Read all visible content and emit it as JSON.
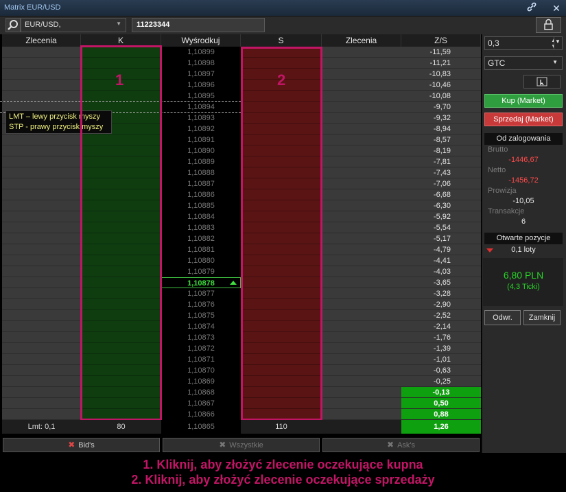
{
  "window": {
    "title": "Matrix EUR/USD"
  },
  "toolbar": {
    "symbol": "EUR/USD,",
    "account": "11223344"
  },
  "headers": {
    "zlecenia_left": "Zlecenia",
    "k": "K",
    "mid": "Wyśrodkuj",
    "s": "S",
    "zlecenia_right": "Zlecenia",
    "zs": "Z/S"
  },
  "rows": [
    {
      "price": "1,10899",
      "pl": "-11,59"
    },
    {
      "price": "1,10898",
      "pl": "-11,21"
    },
    {
      "price": "1,10897",
      "pl": "-10,83"
    },
    {
      "price": "1,10896",
      "pl": "-10,46"
    },
    {
      "price": "1,10895",
      "pl": "-10,08"
    },
    {
      "price": "1,10894",
      "pl": "-9,70"
    },
    {
      "price": "1,10893",
      "pl": "-9,32"
    },
    {
      "price": "1,10892",
      "pl": "-8,94"
    },
    {
      "price": "1,10891",
      "pl": "-8,57"
    },
    {
      "price": "1,10890",
      "pl": "-8,19"
    },
    {
      "price": "1,10889",
      "pl": "-7,81"
    },
    {
      "price": "1,10888",
      "pl": "-7,43"
    },
    {
      "price": "1,10887",
      "pl": "-7,06"
    },
    {
      "price": "1,10886",
      "pl": "-6,68"
    },
    {
      "price": "1,10885",
      "pl": "-6,30"
    },
    {
      "price": "1,10884",
      "pl": "-5,92"
    },
    {
      "price": "1,10883",
      "pl": "-5,54"
    },
    {
      "price": "1,10882",
      "pl": "-5,17"
    },
    {
      "price": "1,10881",
      "pl": "-4,79"
    },
    {
      "price": "1,10880",
      "pl": "-4,41"
    },
    {
      "price": "1,10879",
      "pl": "-4,03"
    },
    {
      "price": "1,10878",
      "pl": "-3,65"
    },
    {
      "price": "1,10877",
      "pl": "-3,28"
    },
    {
      "price": "1,10876",
      "pl": "-2,90"
    },
    {
      "price": "1,10875",
      "pl": "-2,52"
    },
    {
      "price": "1,10874",
      "pl": "-2,14"
    },
    {
      "price": "1,10873",
      "pl": "-1,76"
    },
    {
      "price": "1,10872",
      "pl": "-1,39"
    },
    {
      "price": "1,10871",
      "pl": "-1,01"
    },
    {
      "price": "1,10870",
      "pl": "-0,63"
    },
    {
      "price": "1,10869",
      "pl": "-0,25"
    },
    {
      "price": "1,10868",
      "pl": "-0,13"
    },
    {
      "price": "1,10867",
      "pl": "0,50"
    },
    {
      "price": "1,10866",
      "pl": "0,88"
    }
  ],
  "current_price_index": 21,
  "positive_from_index": 31,
  "footer": {
    "lmt": "Lmt: 0,1",
    "k_total": "80",
    "price": "1,10865",
    "s_total": "110",
    "pl": "1,26"
  },
  "tooltip": {
    "line1": "LMT – lewy przycisk myszy",
    "line2": "STP - prawy przycisk myszy"
  },
  "zones": {
    "buy": "1",
    "sell": "2"
  },
  "tabs": {
    "bids": "Bid's",
    "all": "Wszystkie",
    "asks": "Ask's"
  },
  "side": {
    "quantity": "0,3",
    "tif": "GTC",
    "buy_btn": "Kup (Market)",
    "sell_btn": "Sprzedaj (Market)",
    "since_login": "Od zalogowania",
    "brutto_label": "Brutto",
    "brutto_val": "-1446,67",
    "netto_label": "Netto",
    "netto_val": "-1456,72",
    "prowizja_label": "Prowizja",
    "prowizja_val": "-10,05",
    "transakcje_label": "Transakcje",
    "transakcje_val": "6",
    "open_positions": "Otwarte pozycje",
    "position_lots": "0,1 loty",
    "position_pl": "6,80 PLN",
    "position_ticks": "(4,3 Ticki)",
    "reverse_btn": "Odwr.",
    "close_btn": "Zamknij"
  },
  "colors": {
    "accent": "#c21566",
    "buy": "#2e9e3f",
    "sell": "#c83a3a",
    "positive": "#0fa010"
  },
  "caption": {
    "line1": "1. Kliknij, aby złożyć zlecenie oczekujące kupna",
    "line2": "2. Kliknij, aby złożyć zlecenie oczekujące sprzedaży"
  }
}
